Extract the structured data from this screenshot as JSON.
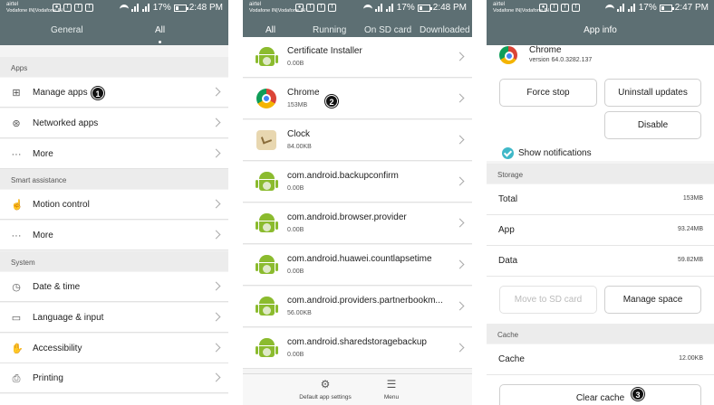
{
  "status": {
    "carrier_top": "airtel",
    "carrier_bottom": "Vodafone IN|Vodafone IN",
    "battery": "17%",
    "times": [
      "2:48 PM",
      "2:48 PM",
      "2:47 PM"
    ]
  },
  "settings": {
    "tabs": [
      "General",
      "All"
    ],
    "active_tab": "All",
    "sections": [
      {
        "title": "Apps",
        "items": [
          {
            "label": "Manage apps",
            "icon": "grid-icon"
          },
          {
            "label": "Networked apps",
            "icon": "network-icon"
          },
          {
            "label": "More",
            "icon": "dots-icon"
          }
        ]
      },
      {
        "title": "Smart assistance",
        "items": [
          {
            "label": "Motion control",
            "icon": "hand-icon"
          },
          {
            "label": "More",
            "icon": "dots-icon"
          }
        ]
      },
      {
        "title": "System",
        "items": [
          {
            "label": "Date & time",
            "icon": "clock-icon"
          },
          {
            "label": "Language & input",
            "icon": "keyboard-icon"
          },
          {
            "label": "Accessibility",
            "icon": "hand-icon"
          },
          {
            "label": "Printing",
            "icon": "printer-icon"
          }
        ]
      }
    ]
  },
  "applist": {
    "tabs": [
      "All",
      "Running",
      "On SD card",
      "Downloaded"
    ],
    "active_tab": "All",
    "apps": [
      {
        "name": "Certificate Installer",
        "size": "0.00B",
        "icon": "android-icon"
      },
      {
        "name": "Chrome",
        "size": "153MB",
        "icon": "chrome-icon"
      },
      {
        "name": "Clock",
        "size": "84.00KB",
        "icon": "clock-app-icon"
      },
      {
        "name": "com.android.backupconfirm",
        "size": "0.00B",
        "icon": "android-icon"
      },
      {
        "name": "com.android.browser.provider",
        "size": "0.00B",
        "icon": "android-icon"
      },
      {
        "name": "com.android.huawei.countlapsetime",
        "size": "0.00B",
        "icon": "android-icon"
      },
      {
        "name": "com.android.providers.partnerbookm...",
        "size": "56.00KB",
        "icon": "android-icon"
      },
      {
        "name": "com.android.sharedstoragebackup",
        "size": "0.00B",
        "icon": "android-icon"
      }
    ],
    "bottom": {
      "default_settings": "Default app settings",
      "menu": "Menu"
    }
  },
  "appinfo": {
    "title": "App info",
    "app_name": "Chrome",
    "version": "version 64.0.3282.137",
    "force_stop": "Force stop",
    "uninstall_updates": "Uninstall updates",
    "disable": "Disable",
    "show_notifications": "Show notifications",
    "storage_title": "Storage",
    "storage": [
      {
        "label": "Total",
        "value": "153MB"
      },
      {
        "label": "App",
        "value": "93.24MB"
      },
      {
        "label": "Data",
        "value": "59.82MB"
      }
    ],
    "move_to_sd": "Move to SD card",
    "manage_space": "Manage space",
    "cache_title": "Cache",
    "cache_label": "Cache",
    "cache_value": "12.00KB",
    "clear_cache": "Clear cache"
  },
  "markers": [
    "1",
    "2",
    "3"
  ]
}
